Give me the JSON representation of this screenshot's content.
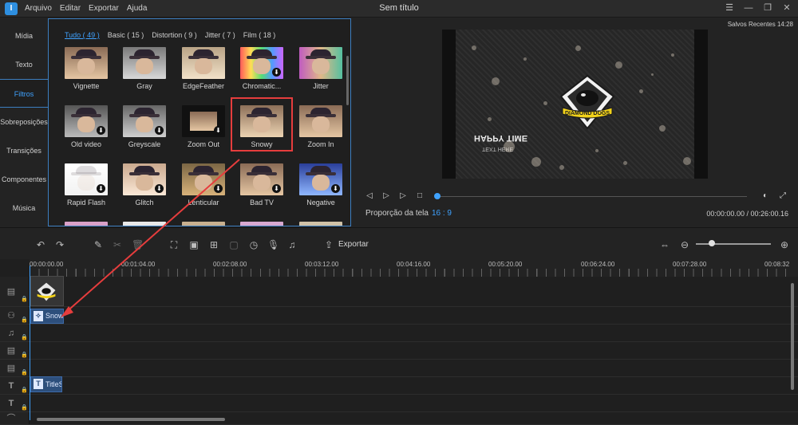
{
  "app": {
    "title": "Sem título",
    "menu": [
      "Arquivo",
      "Editar",
      "Exportar",
      "Ajuda"
    ],
    "logo_text": "I"
  },
  "left_tabs": [
    "Mídia",
    "Texto",
    "Filtros",
    "Sobreposições",
    "Transições",
    "Componentes",
    "Música"
  ],
  "left_tab_active": "Filtros",
  "library": {
    "subtabs": [
      "Tudo ( 49 )",
      "Basic ( 15 )",
      "Distortion ( 9 )",
      "Jitter ( 7 )",
      "Film ( 18 )"
    ],
    "active_subtab": "Tudo ( 49 )",
    "filters": [
      {
        "name": "Vignette",
        "download": false
      },
      {
        "name": "Gray",
        "download": false
      },
      {
        "name": "EdgeFeather",
        "download": false
      },
      {
        "name": "Chromatic...",
        "download": true
      },
      {
        "name": "Jitter",
        "download": false
      },
      {
        "name": "Old video",
        "download": true
      },
      {
        "name": "Greyscale",
        "download": true
      },
      {
        "name": "Zoom Out",
        "download": true
      },
      {
        "name": "Snowy",
        "download": false,
        "selected": true
      },
      {
        "name": "Zoom In",
        "download": false
      },
      {
        "name": "Rapid Flash",
        "download": true
      },
      {
        "name": "Glitch",
        "download": true
      },
      {
        "name": "Lenticular",
        "download": true
      },
      {
        "name": "Bad TV",
        "download": true
      },
      {
        "name": "Negative",
        "download": true
      }
    ]
  },
  "preview": {
    "saved": "Salvos Recentes 14:28",
    "video_text_big": "HAPPY TIME",
    "video_text_small": "TEXT HERE",
    "badge_text": "DIAMOND DOGS",
    "ratio_label": "Proporção da tela",
    "ratio_value": "16 : 9",
    "time": "00:00:00.00 / 00:26:00.16",
    "progress": 0
  },
  "toolbar": {
    "export_label": "Exportar"
  },
  "timeline": {
    "ruler": [
      "00:00:00.00",
      "00:01:04.00",
      "00:02:08.00",
      "00:03:12.00",
      "00:04:16.00",
      "00:05:20.00",
      "00:06:24.00",
      "00:07:28.00",
      "00:08:32"
    ],
    "filter_clip": "Snowy",
    "text_clip": "TitleS"
  },
  "colors": {
    "accent": "#3fa2ff",
    "selection": "#e63d3d",
    "clip": "#2d4f7c"
  }
}
